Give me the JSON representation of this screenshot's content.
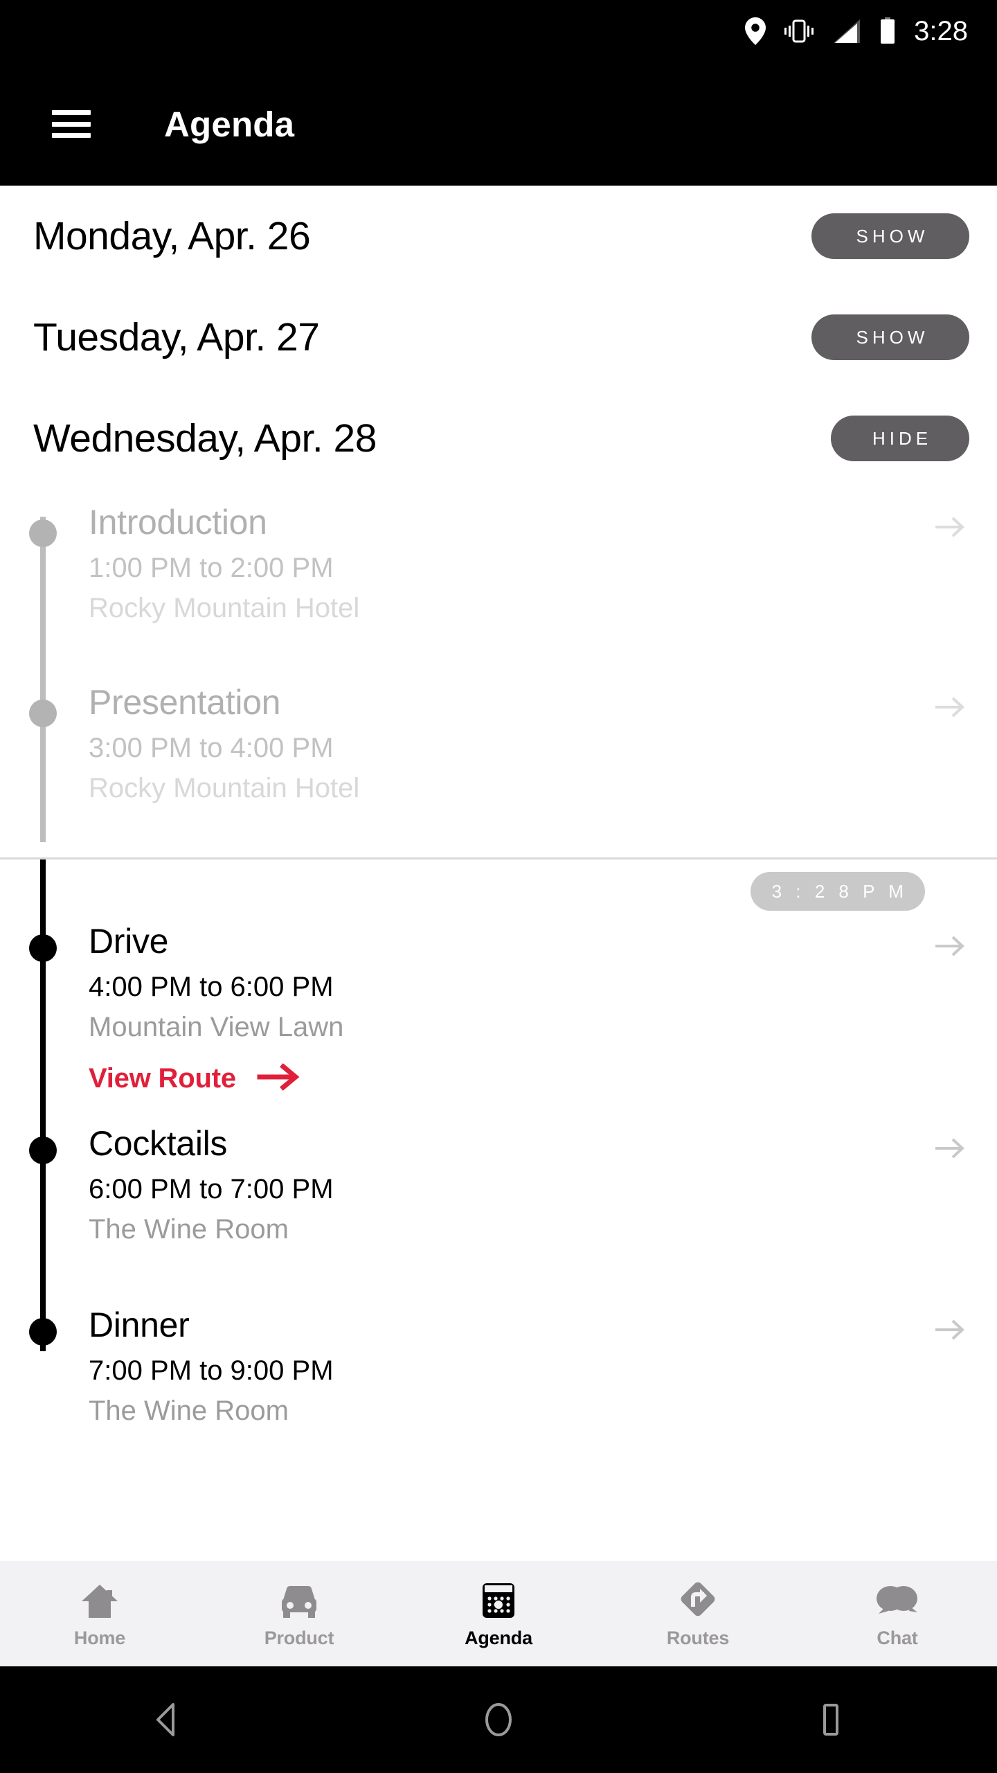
{
  "status_bar": {
    "time": "3:28",
    "icons": [
      "location-pin-icon",
      "vibrate-icon",
      "signal-icon",
      "battery-icon"
    ]
  },
  "app_bar": {
    "menu_icon": "hamburger-menu-icon",
    "title": "Agenda"
  },
  "colors": {
    "accent_red": "#E0203A",
    "pill_gray": "#615E62",
    "now_badge_gray": "#C9C9C9",
    "nav_bg": "#F2F1F3",
    "past_text": "#B0B0B0",
    "place_text": "#9B9B9B"
  },
  "days": [
    {
      "label": "Monday, Apr. 26",
      "toggle": "SHOW",
      "expanded": false
    },
    {
      "label": "Tuesday, Apr. 27",
      "toggle": "SHOW",
      "expanded": false
    },
    {
      "label": "Wednesday, Apr. 28",
      "toggle": "HIDE",
      "expanded": true
    }
  ],
  "now_badge": "3 : 2 8   P M",
  "events_past": [
    {
      "title": "Introduction",
      "time": "1:00 PM to 2:00 PM",
      "place": "Rocky Mountain Hotel"
    },
    {
      "title": "Presentation",
      "time": "3:00 PM to 4:00 PM",
      "place": "Rocky Mountain Hotel"
    }
  ],
  "events_current": [
    {
      "title": "Drive",
      "time": "4:00 PM to 6:00 PM",
      "place": "Mountain View Lawn",
      "route_link": "View Route"
    },
    {
      "title": "Cocktails",
      "time": "6:00 PM to 7:00 PM",
      "place": "The Wine Room"
    },
    {
      "title": "Dinner",
      "time": "7:00 PM to 9:00 PM",
      "place": "The Wine Room"
    }
  ],
  "bottom_nav": [
    {
      "label": "Home",
      "icon": "house-icon",
      "active": false
    },
    {
      "label": "Product",
      "icon": "car-icon",
      "active": false
    },
    {
      "label": "Agenda",
      "icon": "calendar-icon",
      "active": true
    },
    {
      "label": "Routes",
      "icon": "road-sign-icon",
      "active": false
    },
    {
      "label": "Chat",
      "icon": "speech-bubbles-icon",
      "active": false
    }
  ],
  "system_nav": {
    "back": "back-triangle-icon",
    "home": "home-circle-icon",
    "recents": "recents-square-icon"
  }
}
